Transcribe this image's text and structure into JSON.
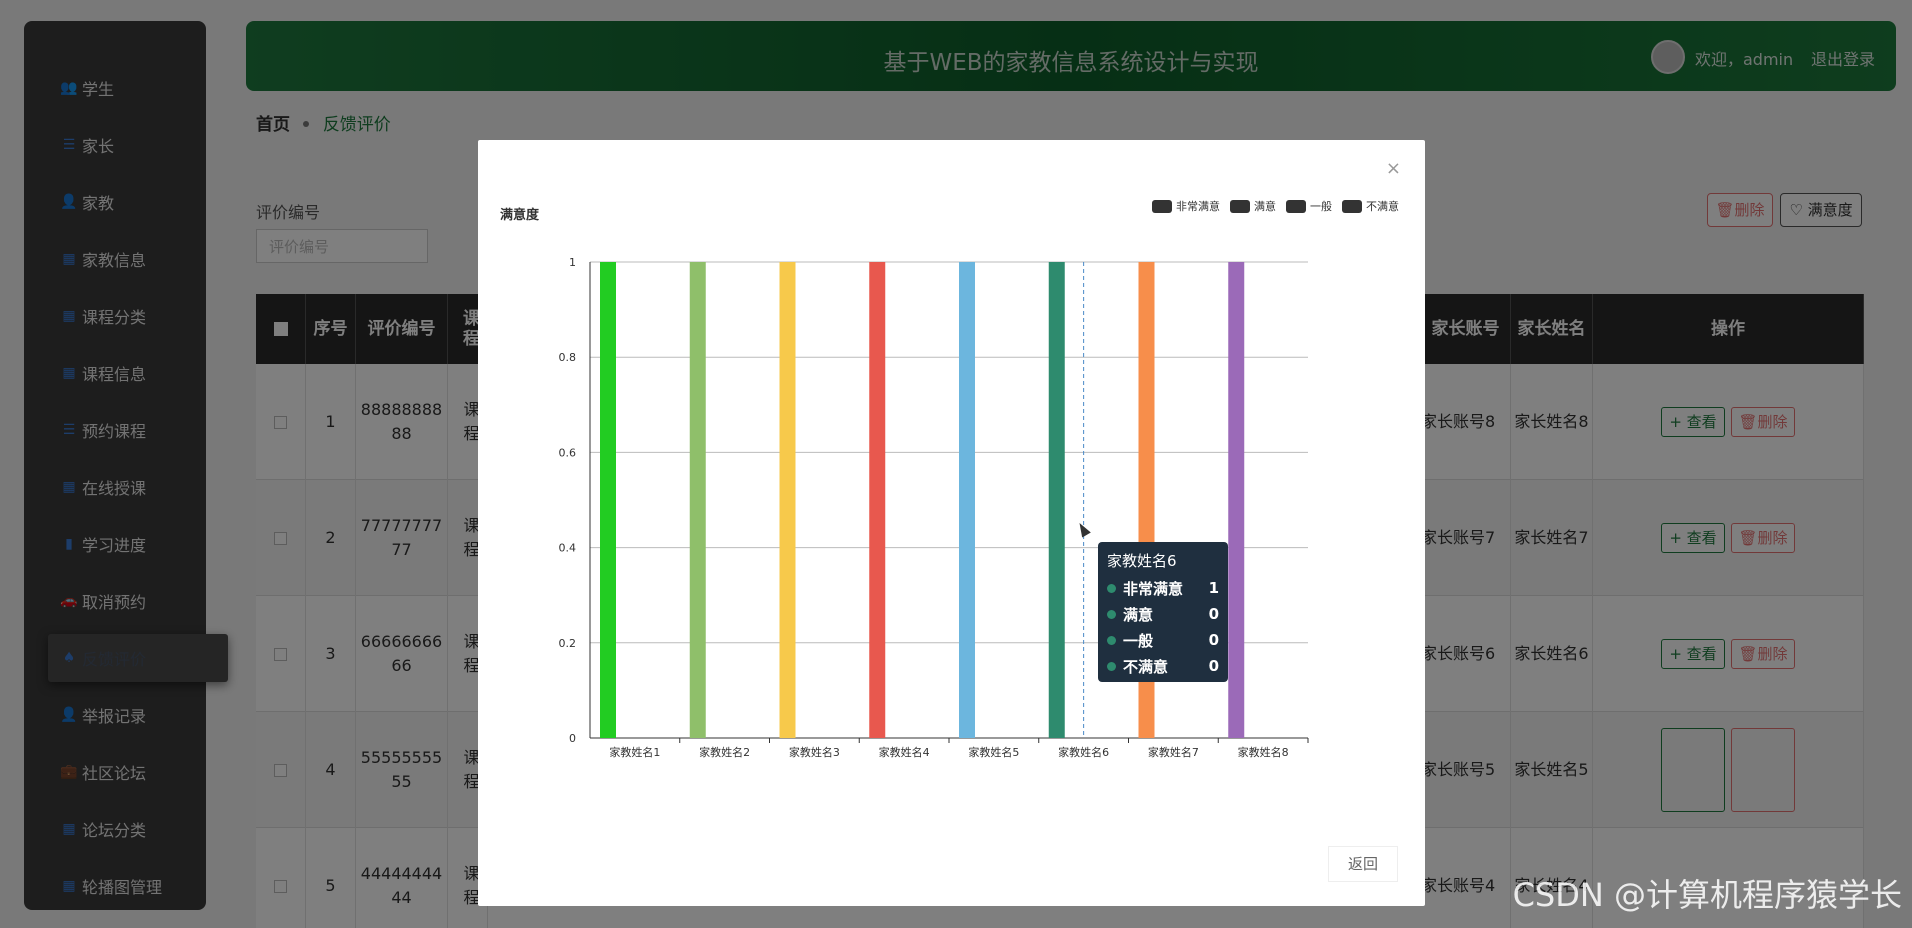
{
  "sidebar": {
    "items": [
      {
        "label": "学生",
        "icon": "users-icon"
      },
      {
        "label": "家长",
        "icon": "list-icon"
      },
      {
        "label": "家教",
        "icon": "user-icon"
      },
      {
        "label": "家教信息",
        "icon": "grid-icon"
      },
      {
        "label": "课程分类",
        "icon": "grid-icon"
      },
      {
        "label": "课程信息",
        "icon": "grid-icon"
      },
      {
        "label": "预约课程",
        "icon": "sliders-icon"
      },
      {
        "label": "在线授课",
        "icon": "grid-icon"
      },
      {
        "label": "学习进度",
        "icon": "bar-chart-icon"
      },
      {
        "label": "取消预约",
        "icon": "car-icon"
      },
      {
        "label": "反馈评价",
        "icon": "tree-icon"
      },
      {
        "label": "举报记录",
        "icon": "user-icon"
      },
      {
        "label": "社区论坛",
        "icon": "briefcase-icon"
      },
      {
        "label": "论坛分类",
        "icon": "grid-icon"
      },
      {
        "label": "轮播图管理",
        "icon": "grid-icon"
      }
    ]
  },
  "header": {
    "title": "基于WEB的家教信息系统设计与实现",
    "welcome": "欢迎，admin",
    "logout": "退出登录"
  },
  "breadcrumb": {
    "home": "首页",
    "current": "反馈评价"
  },
  "filter": {
    "label": "评价编号",
    "placeholder": "评价编号"
  },
  "toolbar": {
    "delete": "删除",
    "satisfaction": "满意度"
  },
  "table": {
    "headers": [
      "序号",
      "评价编号",
      "课程",
      "家长账号",
      "家长姓名",
      "操作"
    ],
    "rows": [
      {
        "no": "1",
        "code": "8888888888",
        "course": "课程",
        "parent_acct": "家长账号8",
        "parent_name": "家长姓名8"
      },
      {
        "no": "2",
        "code": "7777777777",
        "course": "课程",
        "parent_acct": "家长账号7",
        "parent_name": "家长姓名7"
      },
      {
        "no": "3",
        "code": "6666666666",
        "course": "课程",
        "parent_acct": "家长账号6",
        "parent_name": "家长姓名6"
      },
      {
        "no": "4",
        "code": "5555555555",
        "course": "课程",
        "parent_acct": "家长账号5",
        "parent_name": "家长姓名5"
      },
      {
        "no": "5",
        "code": "4444444444",
        "course": "课程",
        "parent_acct": "家长账号4",
        "parent_name": "家长姓名4"
      }
    ],
    "view_label": "查看",
    "delete_label": "删除"
  },
  "modal": {
    "close": "×",
    "back": "返回"
  },
  "chart_data": {
    "type": "bar",
    "title": "满意度",
    "categories": [
      "家教姓名1",
      "家教姓名2",
      "家教姓名3",
      "家教姓名4",
      "家教姓名5",
      "家教姓名6",
      "家教姓名7",
      "家教姓名8"
    ],
    "series": [
      {
        "name": "非常满意",
        "values": [
          1,
          1,
          1,
          1,
          1,
          1,
          1,
          1
        ]
      },
      {
        "name": "满意",
        "values": [
          0,
          0,
          0,
          0,
          0,
          0,
          0,
          0
        ]
      },
      {
        "name": "一般",
        "values": [
          0,
          0,
          0,
          0,
          0,
          0,
          0,
          0
        ]
      },
      {
        "name": "不满意",
        "values": [
          0,
          0,
          0,
          0,
          0,
          0,
          0,
          0
        ]
      }
    ],
    "bar_colors": [
      "#22cc22",
      "#8fbf6a",
      "#f7c94b",
      "#e8584e",
      "#6cb6de",
      "#2e8b6e",
      "#f78e4b",
      "#9b6ab8"
    ],
    "yticks": [
      0,
      0.2,
      0.4,
      0.6,
      0.8,
      1
    ],
    "ylim": [
      0,
      1
    ],
    "legend_placement": "top-right",
    "grid": true,
    "tooltip": {
      "title": "家教姓名6",
      "rows": [
        {
          "name": "非常满意",
          "value": "1"
        },
        {
          "name": "满意",
          "value": "0"
        },
        {
          "name": "一般",
          "value": "0"
        },
        {
          "name": "不满意",
          "value": "0"
        }
      ]
    }
  },
  "watermark": "CSDN @计算机程序猿学长"
}
